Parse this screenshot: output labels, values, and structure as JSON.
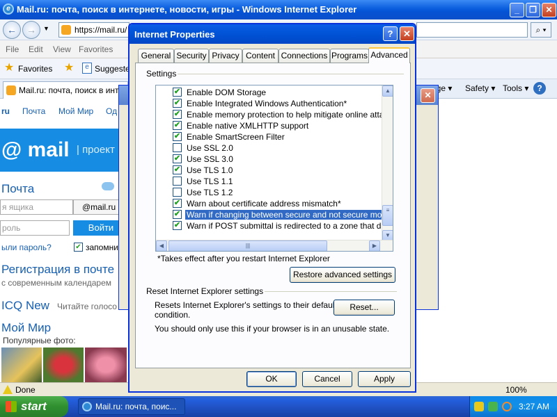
{
  "ie": {
    "title": "Mail.ru: почта, поиск в интернете, новости, игры - Windows Internet Explorer",
    "address": "https://mail.ru/",
    "menu": [
      "File",
      "Edit",
      "View",
      "Favorites"
    ],
    "favorites_label": "Favorites",
    "suggested_label": "Suggested",
    "tab_title": "Mail.ru: почта, поиск в инте",
    "toolbar_right": {
      "page": "age ▾",
      "safety": "Safety ▾",
      "tools": "Tools ▾"
    },
    "status_text": "Done",
    "zoom": "100%"
  },
  "page": {
    "nav": [
      "ru",
      "Почта",
      "Мой Мир",
      "Од"
    ],
    "logo": "@ mail",
    "project": "| проект",
    "pochta_heading": "Почта",
    "login_placeholder": "я ящика",
    "domain": "@mail.ru",
    "password_placeholder": "роль",
    "login_button": "Войти",
    "forgot": "ыли пароль?",
    "remember": "запомни",
    "registration": "Регистрация в почте",
    "registration_sub": "с современным календарем",
    "icq_heading": "ICQ New",
    "icq_sub": "Читайте голосо",
    "moimir_heading": "Мой Мир",
    "popular_photos": "Популярные фото:",
    "colors": {
      "brand": "#168de2",
      "link": "#165fb1"
    }
  },
  "dialog": {
    "title": "Internet Properties",
    "help": "?",
    "close": "✕",
    "tabs": [
      "General",
      "Security",
      "Privacy",
      "Content",
      "Connections",
      "Programs",
      "Advanced"
    ],
    "active_tab": "Advanced",
    "settings_label": "Settings",
    "settings": [
      {
        "label": "Enable DOM Storage",
        "checked": true
      },
      {
        "label": "Enable Integrated Windows Authentication*",
        "checked": true
      },
      {
        "label": "Enable memory protection to help mitigate online attacks*",
        "checked": true
      },
      {
        "label": "Enable native XMLHTTP support",
        "checked": true
      },
      {
        "label": "Enable SmartScreen Filter",
        "checked": true
      },
      {
        "label": "Use SSL 2.0",
        "checked": false
      },
      {
        "label": "Use SSL 3.0",
        "checked": true
      },
      {
        "label": "Use TLS 1.0",
        "checked": true
      },
      {
        "label": "Use TLS 1.1",
        "checked": false
      },
      {
        "label": "Use TLS 1.2",
        "checked": false
      },
      {
        "label": "Warn about certificate address mismatch*",
        "checked": true
      },
      {
        "label": "Warn if changing between secure and not secure mode",
        "checked": true
      },
      {
        "label": "Warn if POST submittal is redirected to a zone that does n",
        "checked": true
      }
    ],
    "selected_setting": "Warn if changing between secure and not secure mode",
    "restart_note": "*Takes effect after you restart Internet Explorer",
    "restore_button": "Restore advanced settings",
    "reset_group_label": "Reset Internet Explorer settings",
    "reset_desc_1": "Resets Internet Explorer's settings to their default",
    "reset_desc_2": "condition.",
    "reset_button": "Reset...",
    "reset_warning": "You should only use this if your browser is in an unusable state.",
    "ok": "OK",
    "cancel": "Cancel",
    "apply": "Apply"
  },
  "taskbar": {
    "start": "start",
    "task_item": "Mail.ru: почта, поис...",
    "clock": "3:27 AM"
  }
}
